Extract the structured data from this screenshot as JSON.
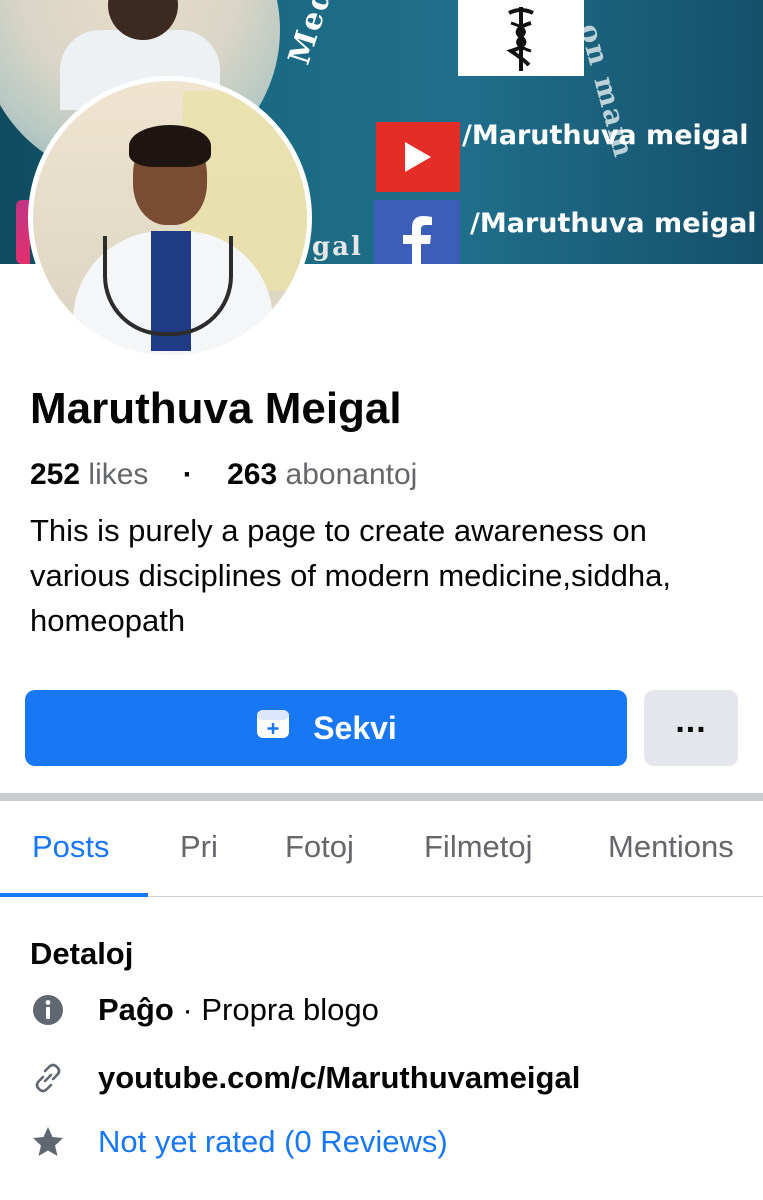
{
  "cover": {
    "ring_text_left": "Medic",
    "ring_text_gal": "gal",
    "ring_text_right": "on mam",
    "youtube_handle": "/Maruthuva meigal",
    "facebook_handle": "/Maruthuva meigal"
  },
  "profile": {
    "name": "Maruthuva Meigal",
    "likes_count": "252",
    "likes_label": "likes",
    "separator": "·",
    "followers_count": "263",
    "followers_label": "abonantoj",
    "about": "This is purely a page to create awareness on various disciplines of modern medicine,siddha, homeopath"
  },
  "actions": {
    "follow_label": "Sekvi",
    "more_label": "..."
  },
  "tabs": [
    {
      "label": "Posts",
      "active": true
    },
    {
      "label": "Pri",
      "active": false
    },
    {
      "label": "Fotoj",
      "active": false
    },
    {
      "label": "Filmetoj",
      "active": false
    },
    {
      "label": "Mentions",
      "active": false
    }
  ],
  "details": {
    "title": "Detaloj",
    "page_type_label": "Paĝo",
    "page_type_sep": " · ",
    "page_type_value": "Propra blogo",
    "website": "youtube.com/c/Maruthuvameigal",
    "rating": "Not yet rated (0 Reviews)"
  },
  "colors": {
    "accent": "#1877f2",
    "text": "#050505",
    "muted": "#65676b",
    "button_secondary": "#e4e6eb"
  },
  "icons": {
    "follow": "follow-plus-icon",
    "more": "more-dots-icon",
    "info": "info-icon",
    "link": "link-icon",
    "star": "star-icon"
  }
}
